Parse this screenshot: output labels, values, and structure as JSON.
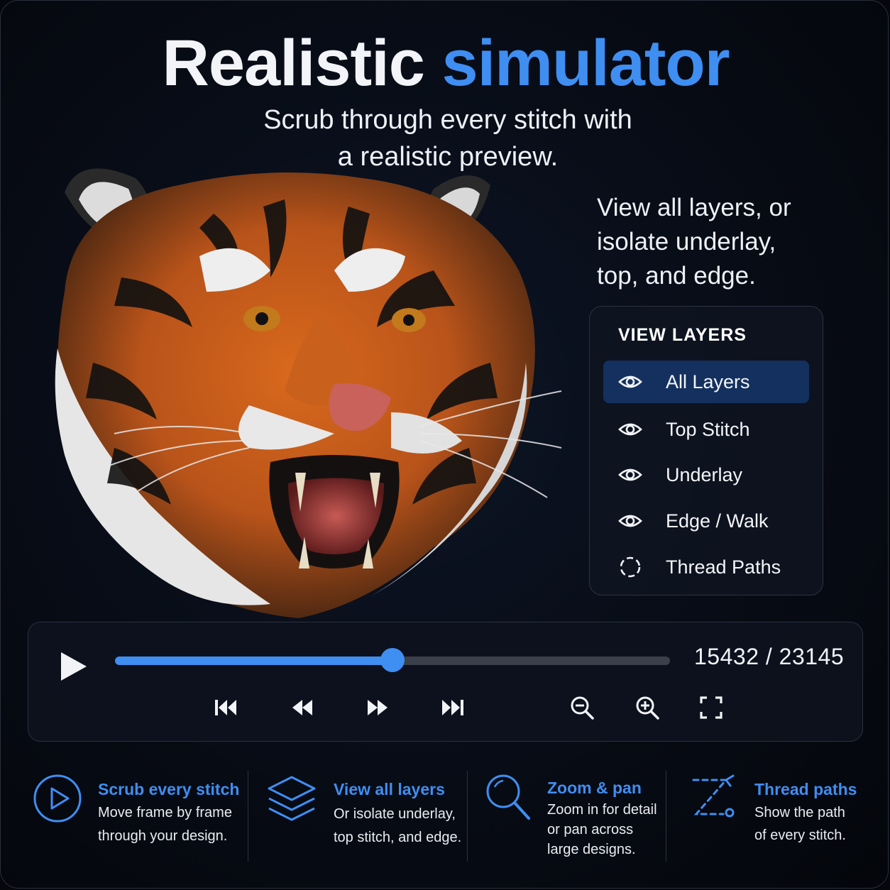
{
  "header": {
    "title_main": "Realistic",
    "title_accent": "simulator",
    "subtitle_line1": "Scrub through every stitch with",
    "subtitle_line2": "a realistic preview."
  },
  "side_description": {
    "line1": "View all layers, or",
    "line2": "isolate underlay,",
    "line3": "top, and edge."
  },
  "layers_panel": {
    "title": "VIEW LAYERS",
    "items": [
      {
        "label": "All Layers",
        "icon": "eye-icon",
        "active": true
      },
      {
        "label": "Top Stitch",
        "icon": "eye-icon",
        "active": false
      },
      {
        "label": "Underlay",
        "icon": "eye-icon",
        "active": false
      },
      {
        "label": "Edge / Walk",
        "icon": "eye-icon",
        "active": false
      },
      {
        "label": "Thread Paths",
        "icon": "dashed-circle-icon",
        "active": false
      }
    ]
  },
  "player": {
    "current_stitch": "15432",
    "separator": "/",
    "total_stitches": "23145",
    "progress_fraction": 0.5
  },
  "features": [
    {
      "title": "Scrub every stitch",
      "line1": "Move frame by frame",
      "line2": "through your design.",
      "line3": "",
      "icon": "play-circle-icon"
    },
    {
      "title": "View all layers",
      "line1": "Or isolate underlay,",
      "line2": "top stitch, and edge.",
      "line3": "",
      "icon": "layers-icon"
    },
    {
      "title": "Zoom & pan",
      "line1": "Zoom in for detail",
      "line2": "or pan across",
      "line3": "large designs.",
      "icon": "magnifier-icon"
    },
    {
      "title": "Thread paths",
      "line1": "Show the path",
      "line2": "of every stitch.",
      "line3": "",
      "icon": "thread-path-icon"
    }
  ],
  "colors": {
    "accent": "#3f8ef2",
    "active_row": "#14305e",
    "background": "#070b14"
  }
}
